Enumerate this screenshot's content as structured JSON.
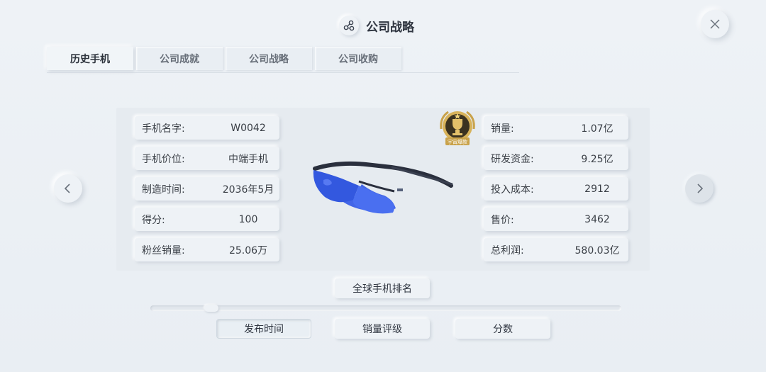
{
  "header": {
    "title": "公司战略",
    "icon": "share-nodes-icon"
  },
  "tabs": [
    {
      "label": "历史手机",
      "active": true
    },
    {
      "label": "公司成就",
      "active": false
    },
    {
      "label": "公司战略",
      "active": false
    },
    {
      "label": "公司收购",
      "active": false
    }
  ],
  "phone": {
    "left_fields": [
      {
        "label": "手机名字:",
        "value": "W0042"
      },
      {
        "label": "手机价位:",
        "value": "中端手机"
      },
      {
        "label": "制造时间:",
        "value": "2036年5月"
      },
      {
        "label": "得分:",
        "value": "100"
      },
      {
        "label": "粉丝销量:",
        "value": "25.06万"
      }
    ],
    "right_fields": [
      {
        "label": "销量:",
        "value": "1.07亿"
      },
      {
        "label": "研发资金:",
        "value": "9.25亿"
      },
      {
        "label": "投入成本:",
        "value": "2912"
      },
      {
        "label": "售价:",
        "value": "3462"
      },
      {
        "label": "总利润:",
        "value": "580.03亿"
      }
    ],
    "image": "blue-sunglasses",
    "badge": {
      "text": "宇宙爆款",
      "icon": "trophy-badge-icon"
    }
  },
  "ranking_button": "全球手机排名",
  "sort_buttons": [
    {
      "label": "发布时间",
      "active": true
    },
    {
      "label": "销量评级",
      "active": false
    },
    {
      "label": "分数",
      "active": false
    }
  ],
  "colors": {
    "background": "#eef2f6",
    "lens_blue": "#2f56e0",
    "frame": "#2a2f3d",
    "badge_gold": "#c9a24a"
  }
}
